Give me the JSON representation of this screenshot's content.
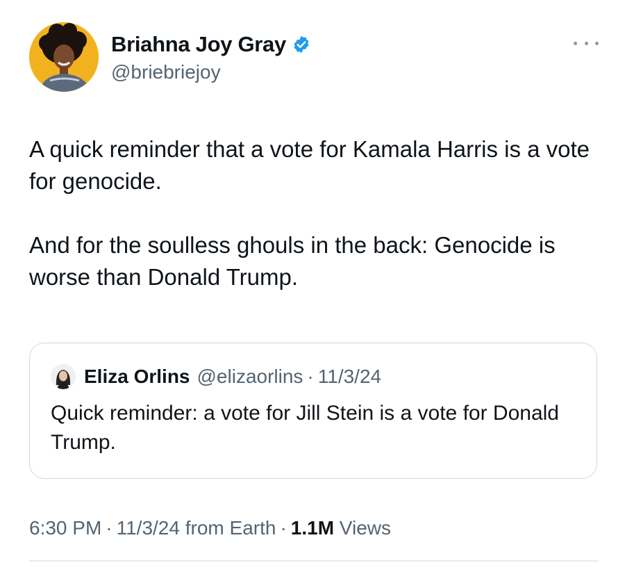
{
  "tweet": {
    "author": {
      "name": "Briahna Joy Gray",
      "handle": "@briebriejoy",
      "verified": true,
      "avatar_bg": "#f2b21f"
    },
    "more_icon": "more-horizontal-icon",
    "text_paragraphs": [
      "A quick reminder that a vote for Kamala Harris is a vote for genocide.",
      "And for the soulless ghouls in the back: Genocide is worse than Donald Trump."
    ],
    "quote": {
      "author_name": "Eliza Orlins",
      "handle": "@elizaorlins",
      "separator": "·",
      "date": "11/3/24",
      "text": "Quick reminder: a vote for Jill Stein is a vote for Donald Trump."
    },
    "meta": {
      "time": "6:30 PM",
      "separator": "·",
      "date": "11/3/24",
      "source": "from Earth",
      "views_count": "1.1M",
      "views_label": "Views"
    }
  },
  "colors": {
    "text_primary": "#0f1419",
    "text_secondary": "#536471",
    "verified_blue": "#1d9bf0",
    "border": "#cfd9de"
  }
}
